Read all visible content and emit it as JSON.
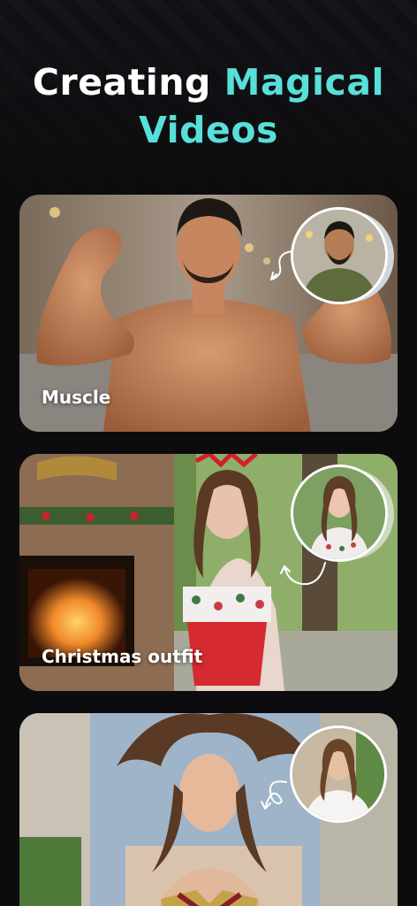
{
  "headline": {
    "line1_white": "Creating ",
    "line1_teal": "Magical",
    "line2_teal": "Videos"
  },
  "colors": {
    "accent": "#58dfd9",
    "background": "#0c0c0e",
    "label": "#ffffff"
  },
  "cards": [
    {
      "label": "Muscle",
      "icon": "curved-arrow-icon"
    },
    {
      "label": "Christmas outfit",
      "icon": "curved-arrow-icon"
    },
    {
      "label": "",
      "icon": "curved-arrow-icon"
    }
  ]
}
